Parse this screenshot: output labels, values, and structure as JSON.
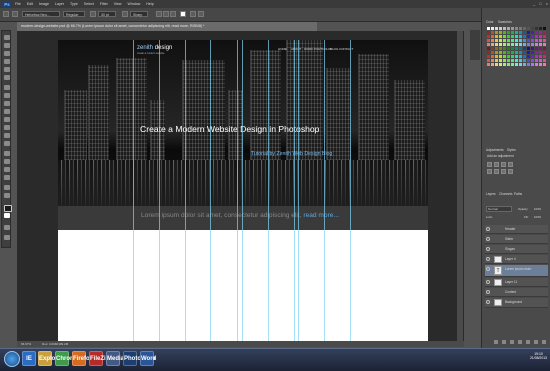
{
  "app": {
    "logo": "Ps",
    "menus": [
      "File",
      "Edit",
      "Image",
      "Layer",
      "Type",
      "Select",
      "Filter",
      "View",
      "Window",
      "Help"
    ],
    "window_controls": [
      "_",
      "□",
      "×"
    ]
  },
  "options": {
    "font_family": "Helvetica Neu...",
    "font_style": "Regular",
    "font_size": "30 pt",
    "anti_alias": "Sharp",
    "workspace": "Essentials"
  },
  "document": {
    "tab_title": "modern-design-website.psd @ 66.7% (Lorem ipsum dolor sit amet, consectetur adipiscing elit, read more, RGB/8) *",
    "zoom": "66.67%",
    "doc_size": "Doc: 3.00M/109.2M"
  },
  "website": {
    "logo_main": "zenith",
    "logo_accent": "design",
    "logo_sub": "create a modern website",
    "nav": [
      "HOME",
      "ABOUT",
      "WORK",
      "PORTFOLIO",
      "BLOG",
      "CONTACT"
    ],
    "hero_title": "Create a Modern Website Design in Photoshop",
    "hero_subtitle": "Tutorial by Zenith Web Design Blog",
    "strip_text": "Lorem ipsum dolor sit amet, consectetur adipiscing elit,",
    "strip_link": "read more..."
  },
  "panels": {
    "color_tabs": [
      "Color",
      "Swatches"
    ],
    "adj_tabs": [
      "Adjustments",
      "Styles"
    ],
    "adj_label": "Add an adjustment",
    "layers_tabs": [
      "Layers",
      "Channels",
      "Paths"
    ],
    "blend_mode": "Normal",
    "opacity_label": "Opacity:",
    "opacity": "100%",
    "fill_label": "Fill:",
    "fill": "100%",
    "lock_label": "Lock:",
    "layers": [
      "Header",
      "Slider",
      "Slogan",
      "Layer 4",
      "Lorem ipsum dolor",
      "Layer 11",
      "Content",
      "Background"
    ]
  },
  "taskbar": {
    "apps": [
      "IE",
      "Explorer",
      "Chrome",
      "Firefox",
      "FileZilla",
      "Media",
      "Photoshop",
      "Word"
    ],
    "time": "19:10",
    "date": "21/08/2013"
  },
  "colors": {
    "accent": "#5fa7dd",
    "ps_blue": "#1b3f73"
  }
}
